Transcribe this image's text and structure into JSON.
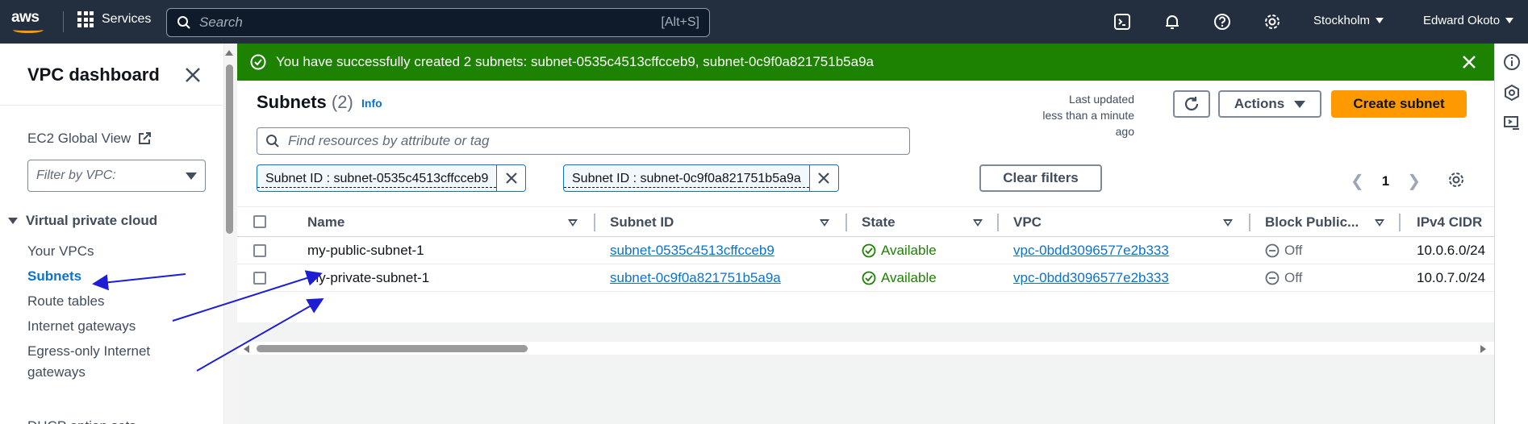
{
  "topnav": {
    "services_label": "Services",
    "search_placeholder": "Search",
    "search_shortcut": "[Alt+S]",
    "region": "Stockholm",
    "user": "Edward Okoto"
  },
  "sidebar": {
    "title": "VPC dashboard",
    "ec2_global_view": "EC2 Global View",
    "filter_placeholder": "Filter by VPC:",
    "section": "Virtual private cloud",
    "items": [
      {
        "label": "Your VPCs"
      },
      {
        "label": "Subnets"
      },
      {
        "label": "Route tables"
      },
      {
        "label": "Internet gateways"
      },
      {
        "label": "Egress-only Internet"
      },
      {
        "label": "gateways"
      },
      {
        "label": "DHCP option sets"
      }
    ]
  },
  "flash": {
    "message": "You have successfully created 2 subnets: subnet-0535c4513cffcceb9, subnet-0c9f0a821751b5a9a",
    "color": "#1d8102"
  },
  "header": {
    "title": "Subnets",
    "count": "(2)",
    "info": "Info",
    "updated_line1": "Last updated",
    "updated_line2": "less than a minute ago",
    "actions_label": "Actions",
    "create_label": "Create subnet"
  },
  "filter": {
    "placeholder": "Find resources by attribute or tag",
    "tokens": [
      {
        "label": "Subnet ID : subnet-0535c4513cffcceb9"
      },
      {
        "label": "Subnet ID : subnet-0c9f0a821751b5a9a"
      }
    ],
    "clear_label": "Clear filters"
  },
  "pagination": {
    "page": "1"
  },
  "table": {
    "columns": [
      "Name",
      "Subnet ID",
      "State",
      "VPC",
      "Block Public...",
      "IPv4 CIDR"
    ],
    "rows": [
      {
        "name": "my-public-subnet-1",
        "subnet_id": "subnet-0535c4513cffcceb9",
        "state": "Available",
        "vpc": "vpc-0bdd3096577e2b333",
        "block_public": "Off",
        "ipv4_cidr": "10.0.6.0/24"
      },
      {
        "name": "my-private-subnet-1",
        "subnet_id": "subnet-0c9f0a821751b5a9a",
        "state": "Available",
        "vpc": "vpc-0bdd3096577e2b333",
        "block_public": "Off",
        "ipv4_cidr": "10.0.7.0/24"
      }
    ]
  },
  "colors": {
    "accent_orange": "#ff9900",
    "link_blue": "#0972d3",
    "success_green": "#1d8102",
    "annotation_arrow": "#1d1dd6"
  }
}
